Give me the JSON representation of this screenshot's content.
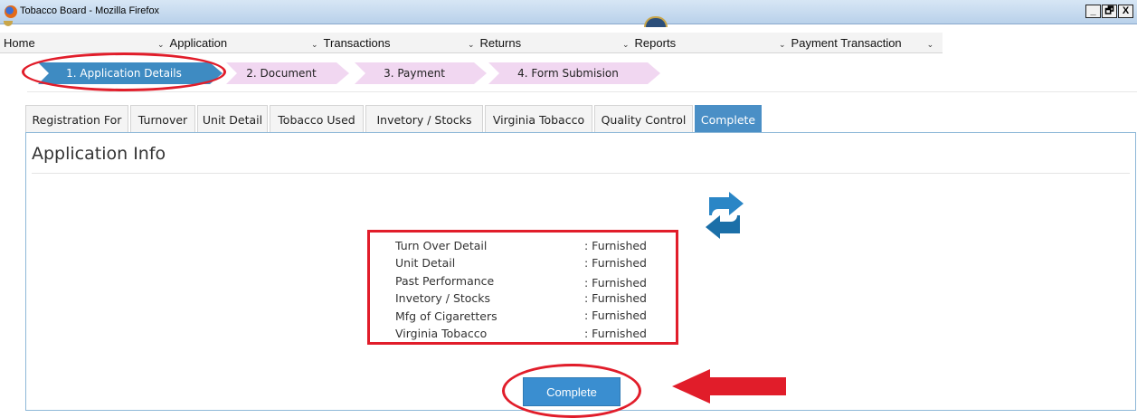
{
  "window": {
    "title": "Tobacco Board - Mozilla Firefox",
    "buttons": [
      "_",
      "ɐ",
      "X"
    ]
  },
  "menu": [
    {
      "label": "Home"
    },
    {
      "label": "Application"
    },
    {
      "label": "Transactions"
    },
    {
      "label": "Returns"
    },
    {
      "label": "Reports"
    },
    {
      "label": "Payment Transaction"
    }
  ],
  "steps": [
    {
      "label": "1. Application Details",
      "active": true
    },
    {
      "label": "2. Document",
      "active": false
    },
    {
      "label": "3. Payment",
      "active": false
    },
    {
      "label": "4. Form Submision",
      "active": false
    }
  ],
  "tabs": [
    {
      "label": "Registration For"
    },
    {
      "label": "Turnover"
    },
    {
      "label": "Unit Detail"
    },
    {
      "label": "Tobacco Used"
    },
    {
      "label": "Invetory / Stocks"
    },
    {
      "label": "Virginia Tobacco"
    },
    {
      "label": "Quality Control"
    },
    {
      "label": "Complete",
      "active": true
    }
  ],
  "panel": {
    "title": "Application Info",
    "status": [
      {
        "label": "Turn Over Detail",
        "value": ": Furnished"
      },
      {
        "label": "Unit Detail",
        "value": ": Furnished"
      },
      {
        "label": "Past Performance",
        "value": ": Furnished"
      },
      {
        "label": "Invetory / Stocks",
        "value": ": Furnished"
      },
      {
        "label": "Mfg of Cigaretters",
        "value": ": Furnished"
      },
      {
        "label": "Virginia Tobacco",
        "value": ": Furnished"
      }
    ],
    "complete_label": "Complete"
  },
  "colors": {
    "accent": "#3e8bc2",
    "step_inactive": "#f1d7f1",
    "annotation": "#e11d2a"
  },
  "icons": [
    "firefox-icon",
    "refresh-icon",
    "chevron-down-icon",
    "red-arrow-annotation"
  ]
}
